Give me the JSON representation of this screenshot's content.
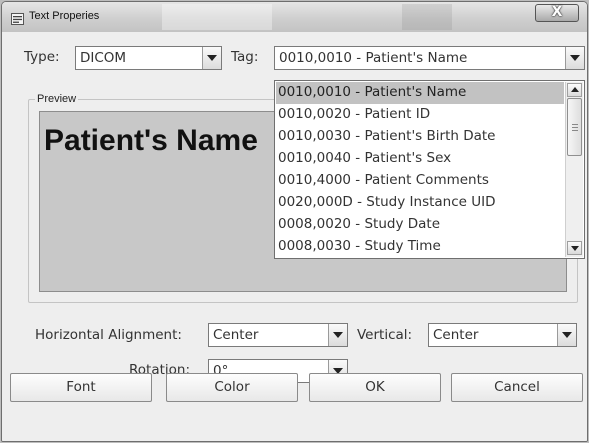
{
  "window": {
    "title": "Text Properies",
    "close_glyph": "X"
  },
  "type_field": {
    "label": "Type:",
    "value": "DICOM"
  },
  "tag_field": {
    "label": "Tag:",
    "value": "0010,0010 - Patient's Name"
  },
  "preview": {
    "legend": "Preview",
    "text": "Patient's Name"
  },
  "tag_dropdown": {
    "selected_index": 0,
    "options": [
      "0010,0010 - Patient's Name",
      "0010,0020 - Patient ID",
      "0010,0030 - Patient's Birth Date",
      "0010,0040 - Patient's Sex",
      "0010,4000 - Patient Comments",
      "0020,000D - Study Instance UID",
      "0008,0020 - Study Date",
      "0008,0030 - Study Time"
    ]
  },
  "horizontal_alignment": {
    "label": "Horizontal Alignment:",
    "value": "Center"
  },
  "vertical_alignment": {
    "label": "Vertical:",
    "value": "Center"
  },
  "rotation": {
    "label": "Rotation:",
    "value": "0°"
  },
  "buttons": {
    "font": "Font",
    "color": "Color",
    "ok": "OK",
    "cancel": "Cancel"
  },
  "icons": {
    "window_icon": "text-properties-icon",
    "close": "close-icon",
    "combo_arrow": "chevron-down-icon"
  }
}
